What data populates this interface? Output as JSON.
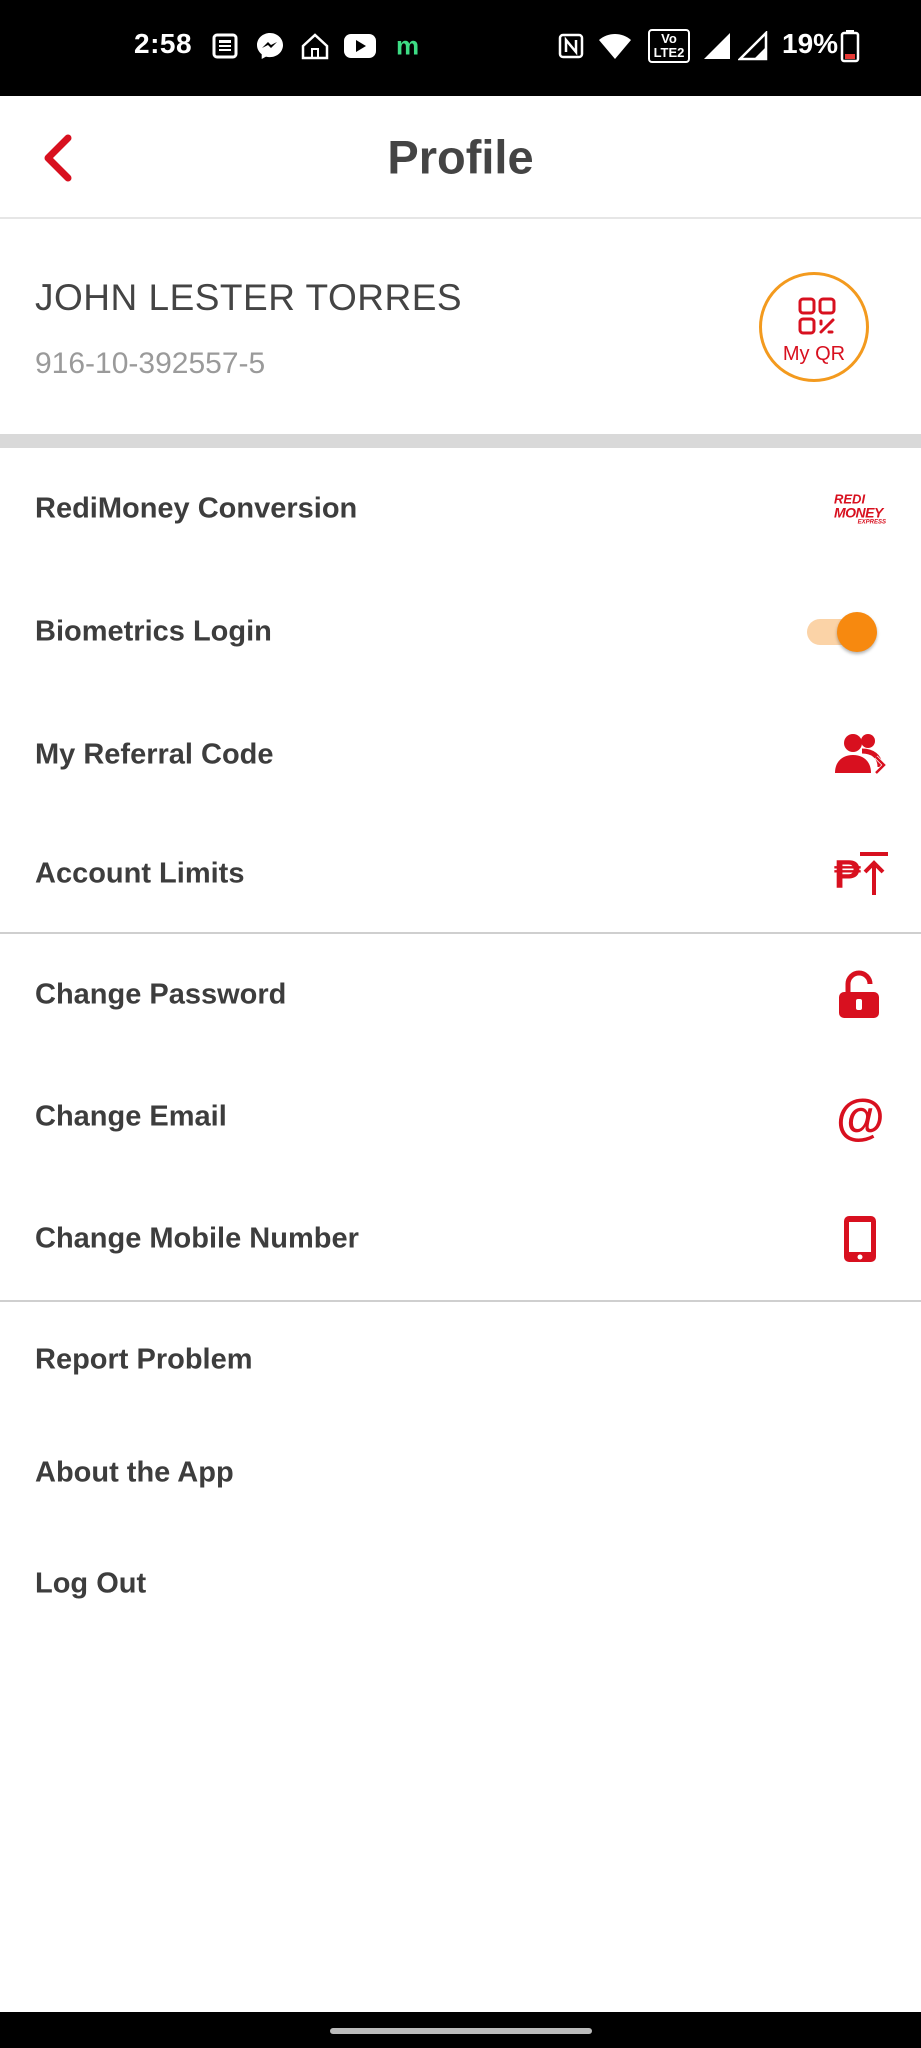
{
  "status_bar": {
    "time": "2:58",
    "battery_percent": "19%",
    "icons": [
      "news-icon",
      "messenger-icon",
      "home-icon",
      "youtube-icon",
      "m-app-icon",
      "nfc-icon",
      "wifi-icon",
      "volte-icon",
      "signal-icon",
      "signal-icon",
      "battery-icon"
    ],
    "m_app_glyph": "m",
    "volte_label": "Vo LTE2"
  },
  "header": {
    "title": "Profile",
    "back_icon": "chevron-left-icon"
  },
  "profile": {
    "name": "JOHN LESTER TORRES",
    "account_number": "916-10-392557-5",
    "qr_label": "My QR"
  },
  "menu": {
    "redimoney": {
      "label": "RediMoney Conversion",
      "logo_line1": "REDI",
      "logo_line2": "MONEY",
      "logo_line3": "EXPRESS"
    },
    "biometrics": {
      "label": "Biometrics Login",
      "enabled": true
    },
    "referral": {
      "label": "My Referral Code",
      "icon": "users-icon"
    },
    "limits": {
      "label": "Account Limits",
      "icon": "peso-up-icon",
      "currency_glyph": "₱"
    },
    "password": {
      "label": "Change Password",
      "icon": "unlock-icon"
    },
    "email": {
      "label": "Change Email",
      "icon": "at-icon",
      "glyph": "@"
    },
    "mobile": {
      "label": "Change Mobile Number",
      "icon": "mobile-icon"
    },
    "report": {
      "label": "Report Problem"
    },
    "about": {
      "label": "About the App"
    },
    "logout": {
      "label": "Log Out"
    }
  },
  "colors": {
    "accent_red": "#d8101f",
    "toggle_orange": "#f7890f",
    "qr_ring": "#f39a1e"
  }
}
